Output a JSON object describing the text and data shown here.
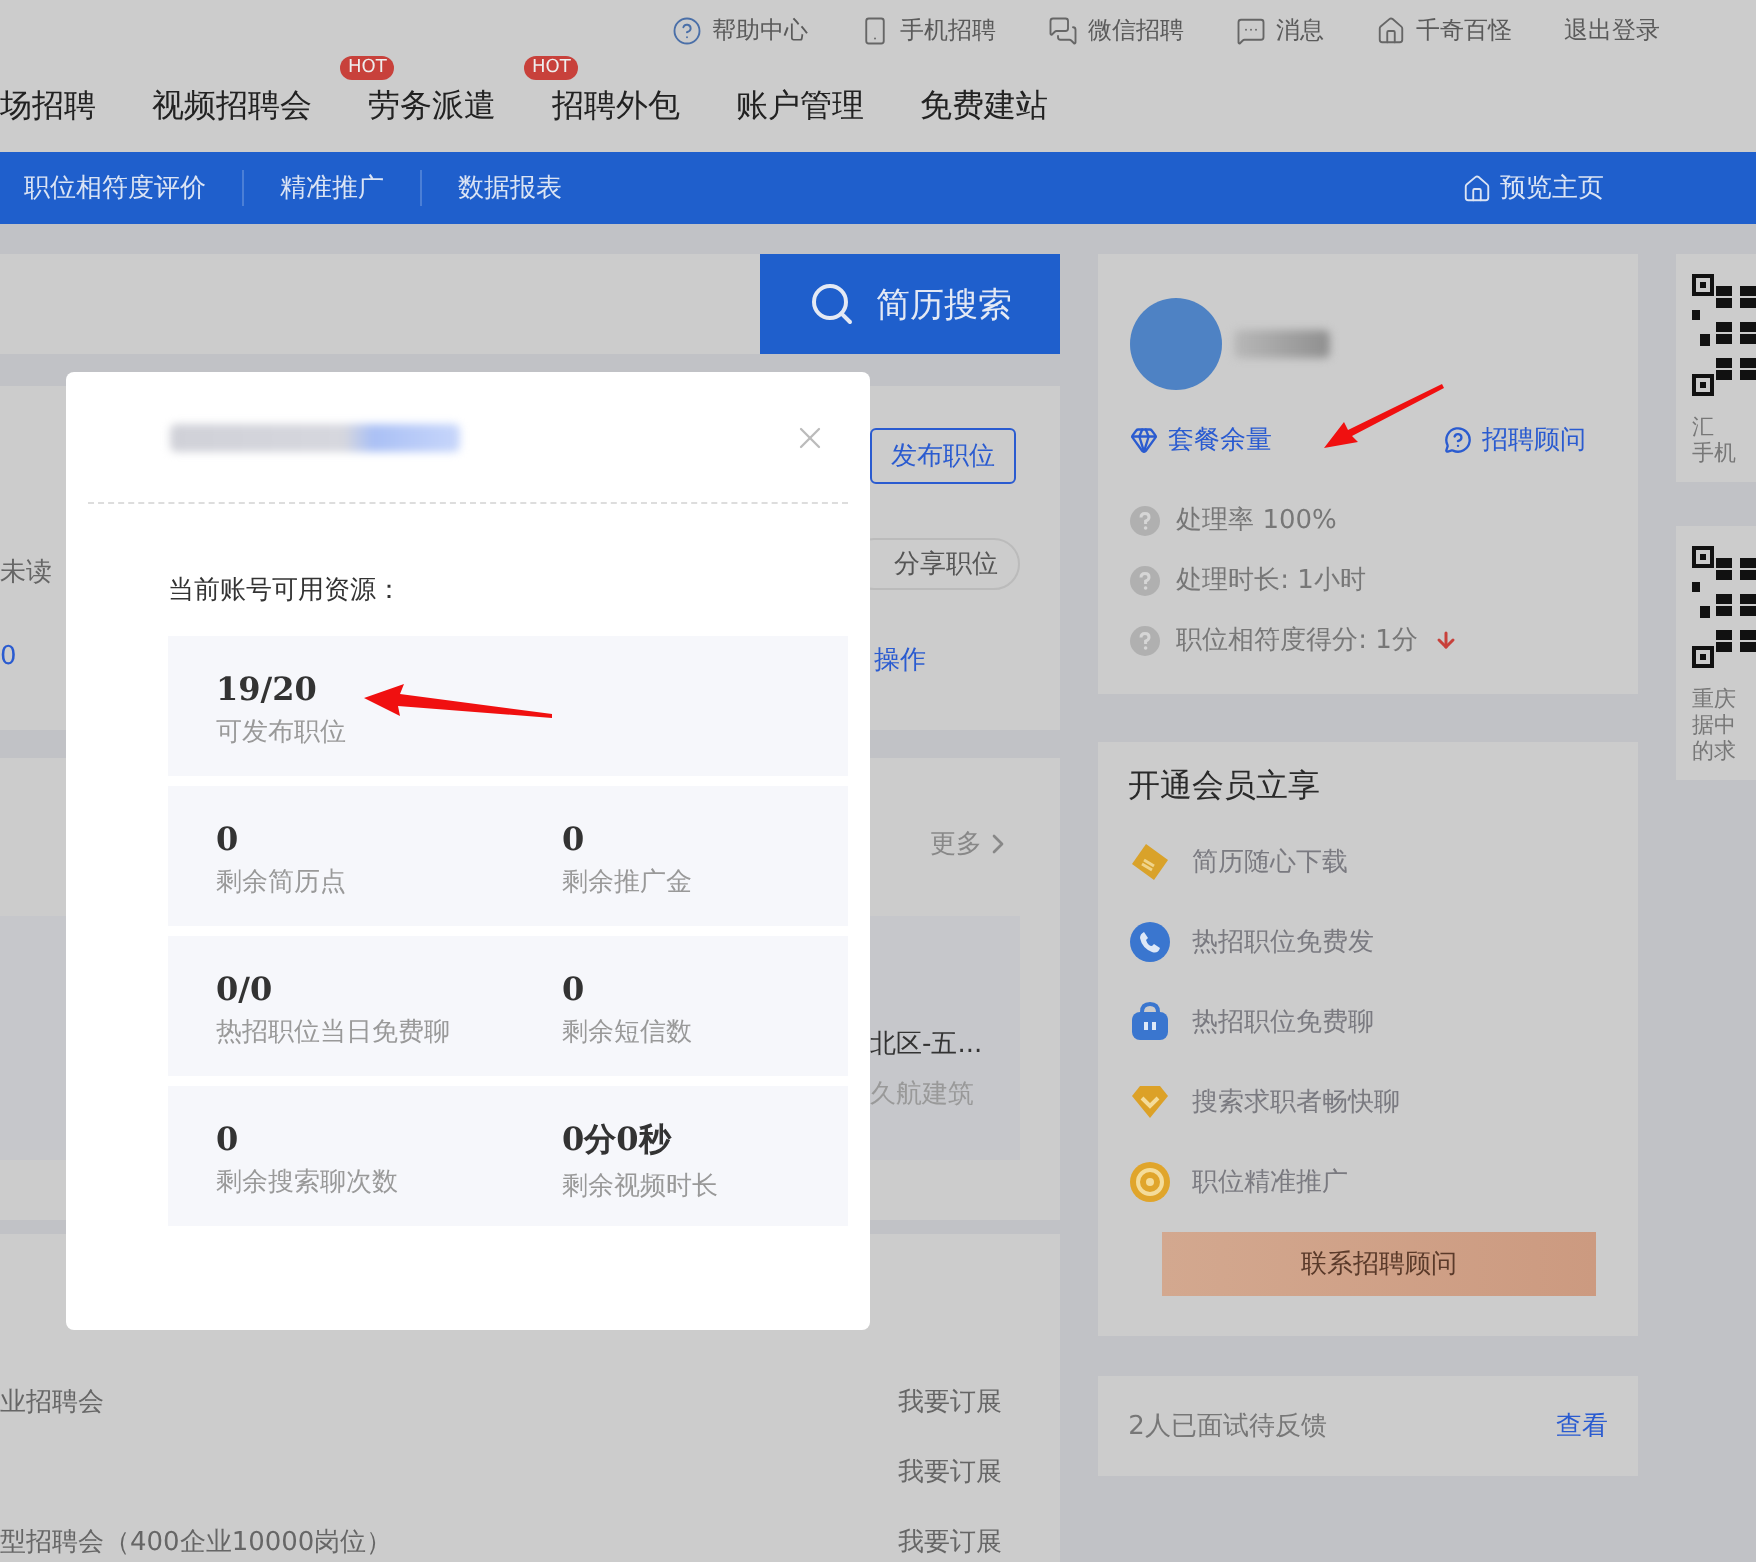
{
  "top_links": [
    {
      "label": "帮助中心",
      "kind": "help"
    },
    {
      "label": "手机招聘",
      "kind": "phone"
    },
    {
      "label": "微信招聘",
      "kind": "wechat"
    },
    {
      "label": "消息",
      "kind": "message"
    },
    {
      "label": "千奇百怪",
      "kind": "home"
    },
    {
      "label": "退出登录",
      "kind": "plain"
    }
  ],
  "main_nav": [
    {
      "label": "场招聘"
    },
    {
      "label": "视频招聘会"
    },
    {
      "label": "劳务派遣",
      "badge": "HOT"
    },
    {
      "label": "招聘外包",
      "badge": "HOT"
    },
    {
      "label": "账户管理"
    },
    {
      "label": "免费建站"
    }
  ],
  "sub_nav": [
    "职位相符度评价",
    "精准推广",
    "数据报表"
  ],
  "preview_link": "预览主页",
  "search_button": "简历搜索",
  "jobs_card": {
    "publish_button": "发布职位",
    "unread_label": "未读",
    "count": "0",
    "share_button": "分享职位",
    "action_link": "操作"
  },
  "featured": {
    "more_link": "更多",
    "location": "北区-五...",
    "company": "久航建筑"
  },
  "fairs": [
    {
      "name": "业招聘会",
      "action": "我要订展"
    },
    {
      "action": "我要订展"
    },
    {
      "name": "型招聘会（400企业10000岗位）",
      "action": "我要订展"
    }
  ],
  "modal": {
    "heading": "当前账号可用资源：",
    "resources": [
      [
        {
          "value": "19/20",
          "label": "可发布职位"
        }
      ],
      [
        {
          "value": "0",
          "label": "剩余简历点"
        },
        {
          "value": "0",
          "label": "剩余推广金"
        }
      ],
      [
        {
          "value": "0/0",
          "label": "热招职位当日免费聊"
        },
        {
          "value": "0",
          "label": "剩余短信数"
        }
      ],
      [
        {
          "value": "0",
          "label": "剩余搜索聊次数"
        },
        {
          "value": "0分0秒",
          "label": "剩余视频时长"
        }
      ]
    ]
  },
  "profile": {
    "package_link": "套餐余量",
    "advisor_link": "招聘顾问",
    "stats": [
      {
        "text": "处理率 100%"
      },
      {
        "text": "处理时长: 1小时"
      },
      {
        "text": "职位相符度得分: 1分",
        "trend_down": true
      }
    ]
  },
  "membership": {
    "title": "开通会员立享",
    "perks": [
      {
        "label": "简历随心下载",
        "kind": "ticket"
      },
      {
        "label": "热招职位免费发",
        "kind": "phone"
      },
      {
        "label": "热招职位免费聊",
        "kind": "bag"
      },
      {
        "label": "搜索求职者畅快聊",
        "kind": "diamond"
      },
      {
        "label": "职位精准推广",
        "kind": "target"
      }
    ],
    "button": "联系招聘顾问"
  },
  "feedback": {
    "text": "2人已面试待反馈",
    "link": "查看"
  },
  "qr_cards": [
    {
      "lines": [
        "汇",
        "手机"
      ]
    },
    {
      "lines": [
        "重庆",
        "据中",
        "的求"
      ]
    }
  ]
}
